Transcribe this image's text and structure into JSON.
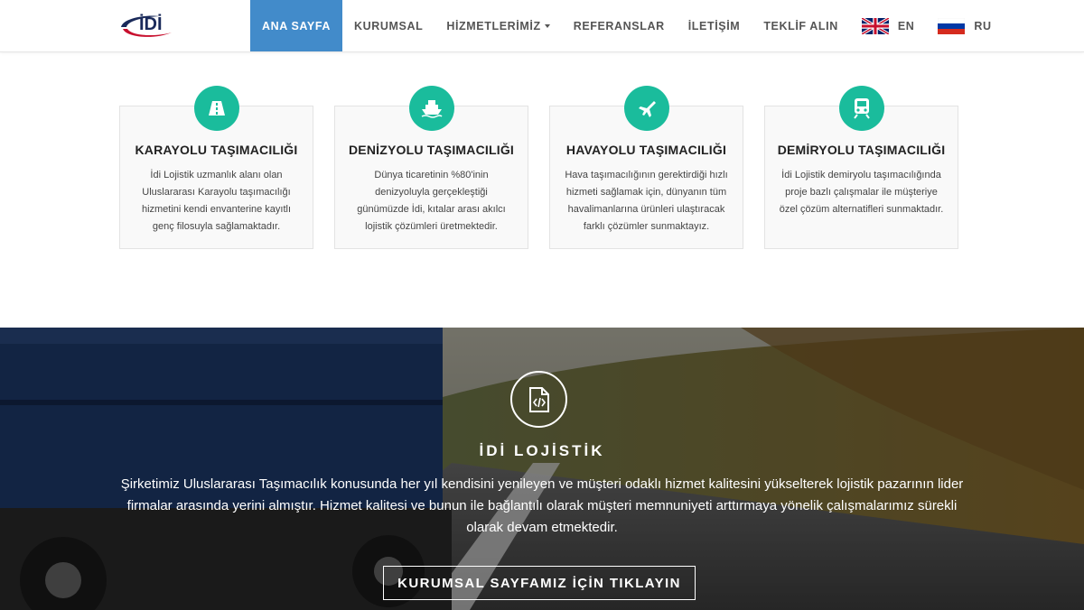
{
  "brand": {
    "logo_text": "İDİ",
    "primary_color": "#428bca",
    "accent_color": "#1abc9c"
  },
  "nav": {
    "items": [
      {
        "label": "ANA SAYFA",
        "active": true
      },
      {
        "label": "KURUMSAL",
        "active": false
      },
      {
        "label": "HİZMETLERİMİZ",
        "active": false,
        "dropdown": true
      },
      {
        "label": "REFERANSLAR",
        "active": false
      },
      {
        "label": "İLETİŞİM",
        "active": false
      },
      {
        "label": "TEKLİF ALIN",
        "active": false
      }
    ],
    "languages": [
      {
        "code": "EN",
        "flag": "uk-flag-icon"
      },
      {
        "code": "RU",
        "flag": "russia-flag-icon"
      }
    ]
  },
  "services": [
    {
      "icon": "road-icon",
      "title": "KARAYOLU TAŞIMACILIĞI",
      "text": "İdi Lojistik uzmanlık alanı olan Uluslararası Karayolu taşımacılığı hizmetini kendi envanterine kayıtlı genç filosuyla sağlamaktadır."
    },
    {
      "icon": "ship-icon",
      "title": "DENİZYOLU TAŞIMACILIĞI",
      "text": "Dünya ticaretinin %80'inin denizyoluyla gerçekleştiği günümüzde İdi, kıtalar arası akılcı lojistik çözümleri üretmektedir."
    },
    {
      "icon": "plane-icon",
      "title": "HAVAYOLU TAŞIMACILIĞI",
      "text": "Hava taşımacılığının gerektirdiği hızlı hizmeti sağlamak için, dünyanın tüm havalimanlarına ürünleri ulaştıracak farklı çözümler sunmaktayız."
    },
    {
      "icon": "train-icon",
      "title": "DEMİRYOLU TAŞIMACILIĞI",
      "text": "İdi Lojistik demiryolu taşımacılığında proje bazlı çalışmalar ile müşteriye özel çözüm alternatifleri sunmaktadır."
    }
  ],
  "hero": {
    "icon": "code-file-icon",
    "title": "İDİ LOJİSTİK",
    "text": "Şirketimiz Uluslararası Taşımacılık konusunda her yıl kendisini yenileyen ve müşteri odaklı hizmet kalitesini yükselterek lojistik pazarının lider firmalar arasında yerini almıştır. Hizmet kalitesi ve bunun ile bağlantılı olarak müşteri memnuniyeti arttırmaya yönelik çalışmalarımız sürekli olarak devam etmektedir.",
    "button_label": "KURUMSAL SAYFAMIZ İÇİN TIKLAYIN"
  }
}
